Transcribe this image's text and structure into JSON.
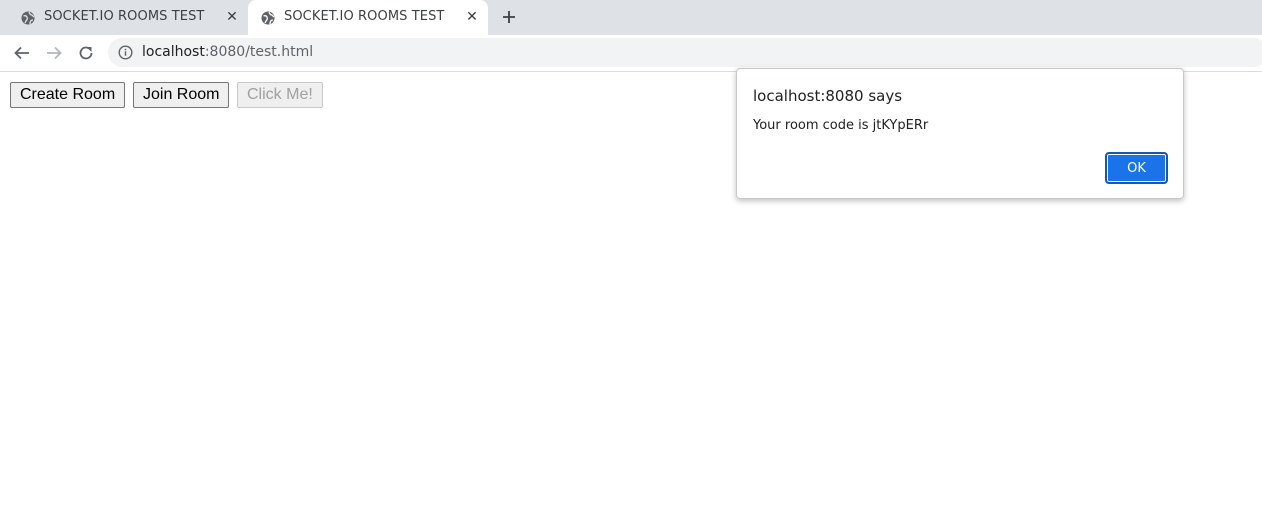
{
  "browser": {
    "tabs": [
      {
        "title": "SOCKET.IO ROOMS TEST",
        "close_icon": "close-icon",
        "active": false
      },
      {
        "title": "SOCKET.IO ROOMS TEST",
        "close_icon": "close-icon",
        "active": true
      }
    ],
    "new_tab_icon": "plus-icon",
    "close_glyph": "✕",
    "address_bar": {
      "host": "localhost",
      "path": ":8080/test.html",
      "security_icon": "info-icon"
    },
    "nav_icons": [
      "back-arrow-icon",
      "forward-arrow-icon",
      "reload-icon"
    ]
  },
  "page": {
    "buttons": [
      {
        "label": "Create Room",
        "disabled": false
      },
      {
        "label": "Join Room",
        "disabled": false
      },
      {
        "label": "Click Me!",
        "disabled": true
      }
    ]
  },
  "dialog": {
    "title": "localhost:8080 says",
    "message": "Your room code is jtKYpERr",
    "ok_label": "OK"
  },
  "colors": {
    "tabstrip_bg": "#dee1e6",
    "omnibox_bg": "#f1f3f4",
    "accent_blue": "#1a73e8"
  }
}
